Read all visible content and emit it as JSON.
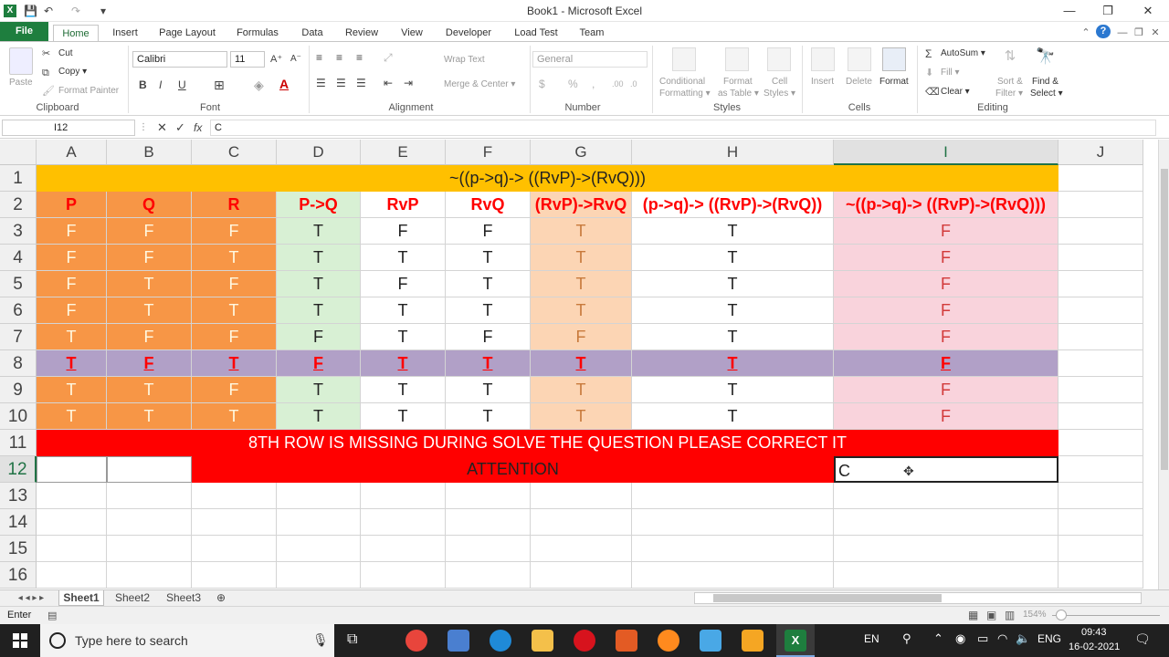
{
  "window": {
    "title": "Book1  -  Microsoft Excel",
    "minimize": "—",
    "restore": "❐",
    "close": "✕"
  },
  "qat": {
    "app_icon": "X",
    "save": "💾",
    "undo": "↶",
    "redo": "↷"
  },
  "tabs": [
    "File",
    "Home",
    "Insert",
    "Page Layout",
    "Formulas",
    "Data",
    "Review",
    "View",
    "Developer",
    "Load Test",
    "Team"
  ],
  "ribbon": {
    "clipboard": {
      "paste": "Paste",
      "cut": "Cut",
      "copy": "Copy ▾",
      "format_painter": "Format Painter",
      "label": "Clipboard"
    },
    "font": {
      "name": "Calibri",
      "size": "11",
      "label": "Font",
      "bold": "B",
      "italic": "I",
      "underline": "U"
    },
    "alignment": {
      "wrap_text": "Wrap Text",
      "merge_center": "Merge & Center ▾",
      "label": "Alignment"
    },
    "number": {
      "format": "General",
      "percent": "%",
      "comma": ",",
      "label": "Number"
    },
    "styles": {
      "conditional": "Conditional",
      "conditional2": "Formatting ▾",
      "format_table": "Format",
      "format_table2": "as Table ▾",
      "cell_styles": "Cell",
      "cell_styles2": "Styles ▾",
      "label": "Styles"
    },
    "cells": {
      "insert": "Insert",
      "delete": "Delete",
      "format": "Format",
      "label": "Cells"
    },
    "editing": {
      "autosum": "AutoSum ▾",
      "fill": "Fill ▾",
      "clear": "Clear ▾",
      "sort": "Sort &",
      "sort2": "Filter ▾",
      "find": "Find &",
      "find2": "Select ▾",
      "label": "Editing"
    }
  },
  "formula_bar": {
    "name_box": "I12",
    "fx": "fx",
    "content": "C"
  },
  "columns": [
    "A",
    "B",
    "C",
    "D",
    "E",
    "F",
    "G",
    "H",
    "I",
    "J"
  ],
  "rows": [
    "1",
    "2",
    "3",
    "4",
    "5",
    "6",
    "7",
    "8",
    "9",
    "10",
    "11",
    "12",
    "13",
    "14",
    "15",
    "16"
  ],
  "sheet": {
    "title_row": "~((p->q)-> ((RvP)->(RvQ)))",
    "headers": [
      "P",
      "Q",
      "R",
      "P->Q",
      "RvP",
      "RvQ",
      "(RvP)->RvQ",
      "(p->q)-> ((RvP)->(RvQ))",
      "~((p->q)-> ((RvP)->(RvQ)))"
    ],
    "data": [
      [
        "F",
        "F",
        "F",
        "T",
        "F",
        "F",
        "T",
        "T",
        "F"
      ],
      [
        "F",
        "F",
        "T",
        "T",
        "T",
        "T",
        "T",
        "T",
        "F"
      ],
      [
        "F",
        "T",
        "F",
        "T",
        "F",
        "T",
        "T",
        "T",
        "F"
      ],
      [
        "F",
        "T",
        "T",
        "T",
        "T",
        "T",
        "T",
        "T",
        "F"
      ],
      [
        "T",
        "F",
        "F",
        "F",
        "T",
        "F",
        "F",
        "T",
        "F"
      ],
      [
        "T",
        "F",
        "T",
        "F",
        "T",
        "T",
        "T",
        "T",
        "F"
      ],
      [
        "T",
        "T",
        "F",
        "T",
        "T",
        "T",
        "T",
        "T",
        "F"
      ],
      [
        "T",
        "T",
        "T",
        "T",
        "T",
        "T",
        "T",
        "T",
        "F"
      ]
    ],
    "notice": "8TH ROW IS MISSING DURING SOLVE THE QUESTION PLEASE CORRECT IT",
    "attention": "ATTENTION",
    "active_cell_value": "C"
  },
  "sheet_tabs": [
    "Sheet1",
    "Sheet2",
    "Sheet3"
  ],
  "status": {
    "mode": "Enter",
    "zoom": "154%"
  },
  "taskbar": {
    "search_placeholder": "Type here to search",
    "lang1": "EN",
    "lang2": "ENG",
    "time": "09:43",
    "date": "16-02-2021"
  },
  "colors": {
    "orange": "#f79646",
    "green": "#d8f0d4",
    "peach": "#fcd5b4",
    "pink": "#f9d3dc",
    "purple": "#b1a0c7",
    "yellow": "#ffc000",
    "red": "#ff0000",
    "excel_green": "#217346"
  }
}
